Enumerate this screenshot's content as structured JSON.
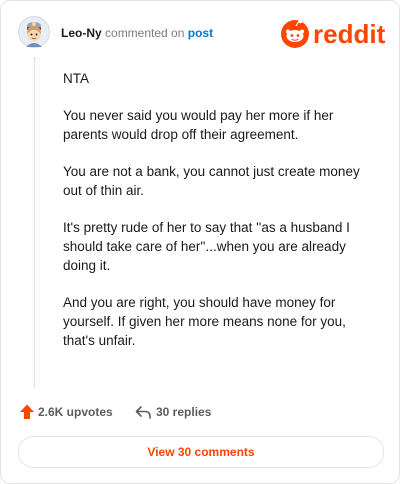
{
  "comment": {
    "author": "Leo-Ny",
    "action_text": "commented on",
    "post_link_text": "post",
    "paragraphs": [
      "NTA",
      "You never said you would pay her more if her parents would drop off their agreement.",
      "You are not a bank, you cannot just create money out of thin air.",
      "It's pretty rude of her to say that ''as a husband I should take care of her''...when you are already doing it.",
      "And you are right, you should have money for yourself. If given her more means none for you, that's unfair."
    ]
  },
  "brand": {
    "logo_text": "reddit",
    "color": "#ff4500"
  },
  "footer": {
    "upvotes_label": "2.6K upvotes",
    "replies_label": "30 replies",
    "view_comments_label": "View 30 comments"
  },
  "icons": {
    "avatar": "avatar-icon",
    "logo": "reddit-logo-icon",
    "upvote": "upvote-arrow-icon",
    "reply": "reply-arrow-icon"
  }
}
